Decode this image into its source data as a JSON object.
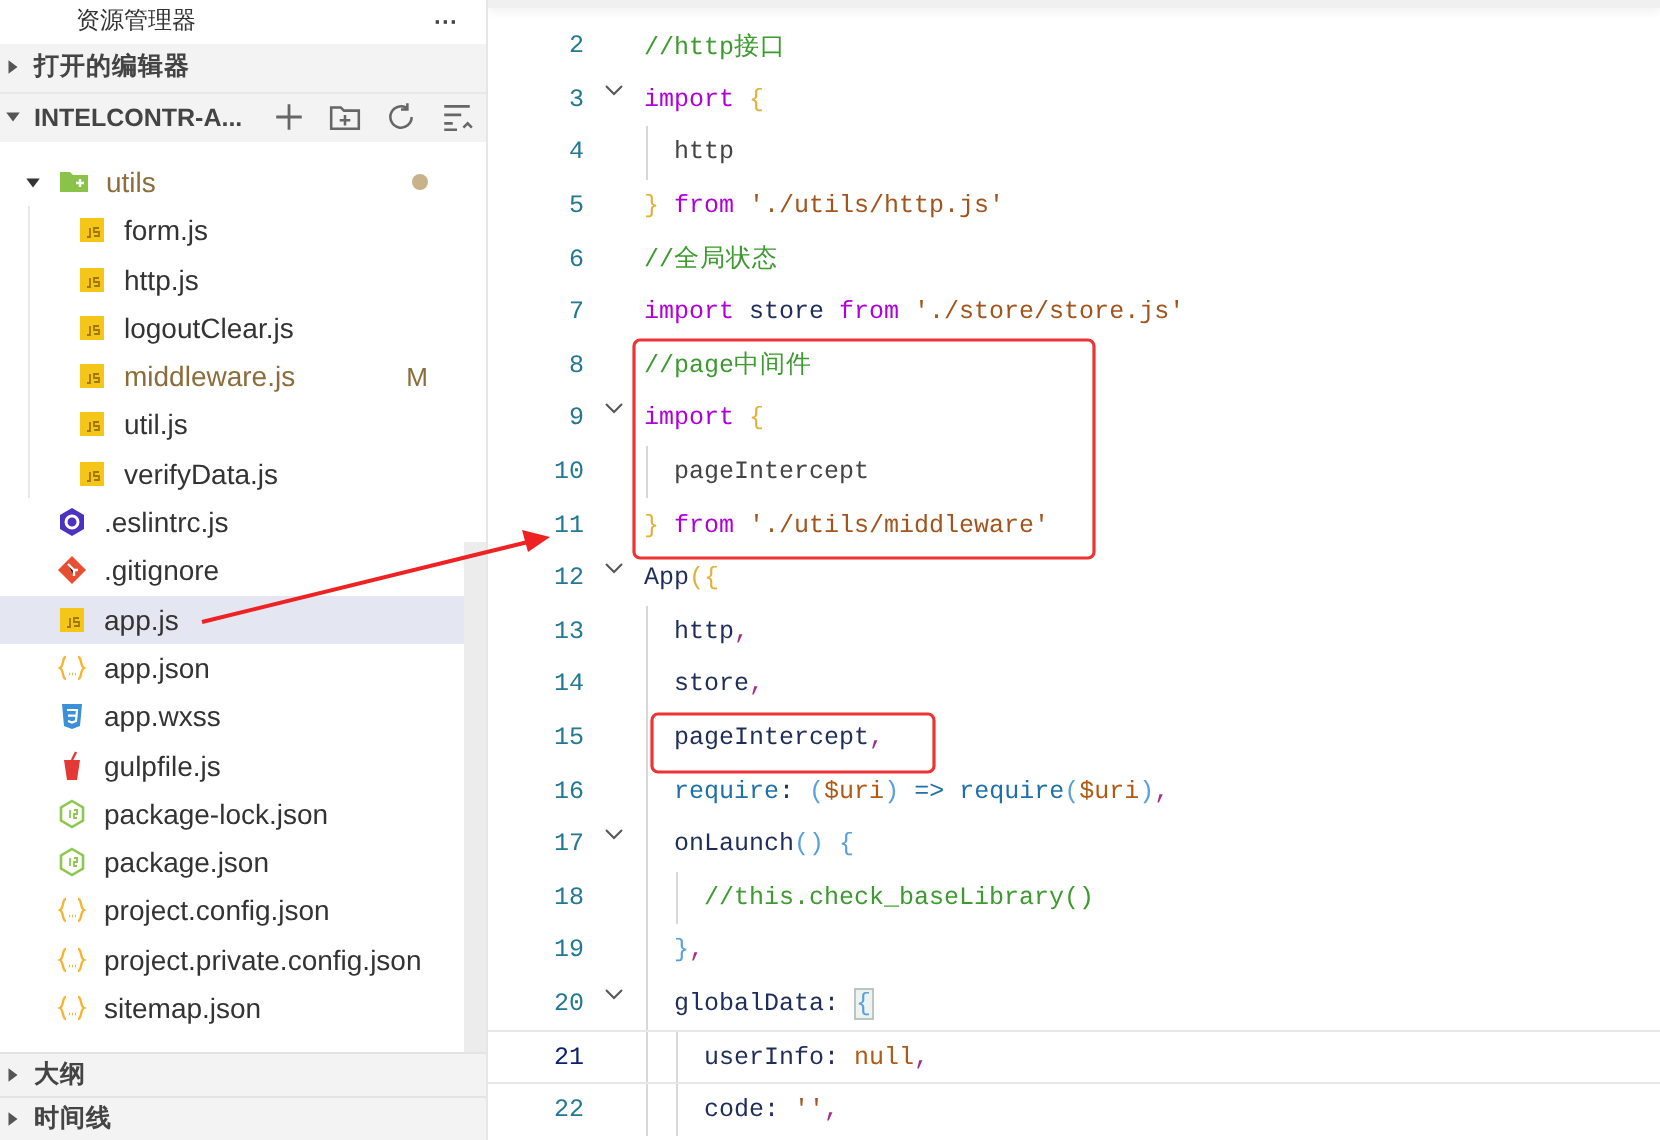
{
  "sidebar": {
    "title": "资源管理器",
    "more": "···",
    "sections_top": [
      {
        "label": "打开的编辑器",
        "expanded": false
      }
    ],
    "project": {
      "label": "INTELCONTR-A...",
      "expanded": true
    },
    "tree": [
      {
        "name": "utils",
        "kind": "folder",
        "expanded": true,
        "modified": true,
        "selected": false,
        "children": [
          {
            "name": "form.js",
            "kind": "js",
            "modified": false,
            "selected": false
          },
          {
            "name": "http.js",
            "kind": "js",
            "modified": false,
            "selected": false
          },
          {
            "name": "logoutClear.js",
            "kind": "js",
            "modified": false,
            "selected": false
          },
          {
            "name": "middleware.js",
            "kind": "js",
            "modified": true,
            "badge": "M",
            "selected": false
          },
          {
            "name": "util.js",
            "kind": "js",
            "modified": false,
            "selected": false
          },
          {
            "name": "verifyData.js",
            "kind": "js",
            "modified": false,
            "selected": false
          }
        ]
      },
      {
        "name": ".eslintrc.js",
        "kind": "eslint",
        "modified": false,
        "selected": false
      },
      {
        "name": ".gitignore",
        "kind": "git",
        "modified": false,
        "selected": false
      },
      {
        "name": "app.js",
        "kind": "js",
        "modified": false,
        "selected": true
      },
      {
        "name": "app.json",
        "kind": "json",
        "modified": false,
        "selected": false
      },
      {
        "name": "app.wxss",
        "kind": "css",
        "modified": false,
        "selected": false
      },
      {
        "name": "gulpfile.js",
        "kind": "gulp",
        "modified": false,
        "selected": false
      },
      {
        "name": "package-lock.json",
        "kind": "node",
        "modified": false,
        "selected": false
      },
      {
        "name": "package.json",
        "kind": "node",
        "modified": false,
        "selected": false
      },
      {
        "name": "project.config.json",
        "kind": "json",
        "modified": false,
        "selected": false
      },
      {
        "name": "project.private.config.json",
        "kind": "json",
        "modified": false,
        "selected": false
      },
      {
        "name": "sitemap.json",
        "kind": "json",
        "modified": false,
        "selected": false
      }
    ],
    "sections_bottom": [
      {
        "label": "大纲",
        "expanded": false
      },
      {
        "label": "时间线",
        "expanded": false
      }
    ]
  },
  "editor": {
    "lines": [
      {
        "number": "2",
        "current": false,
        "tokens": [
          {
            "kind": "comment",
            "text": "//http接口"
          }
        ]
      },
      {
        "number": "3",
        "current": false,
        "expanded": true,
        "tokens": [
          {
            "kind": "keyword",
            "text": "import"
          },
          {
            "kind": "brace",
            "text": " {"
          }
        ],
        "children": [
          {
            "number": "4",
            "current": false,
            "tokens": [
              {
                "kind": "plain",
                "text": "http"
              }
            ]
          }
        ]
      },
      {
        "number": "5",
        "current": false,
        "tokens": [
          {
            "kind": "brace",
            "text": "}"
          },
          {
            "kind": "keyword",
            "text": " from "
          },
          {
            "kind": "string",
            "text": "'./utils/http.js'"
          }
        ]
      },
      {
        "number": "6",
        "current": false,
        "tokens": [
          {
            "kind": "comment",
            "text": "//全局状态"
          }
        ]
      },
      {
        "number": "7",
        "current": false,
        "tokens": [
          {
            "kind": "keyword",
            "text": "import "
          },
          {
            "kind": "variable",
            "text": "store"
          },
          {
            "kind": "keyword",
            "text": " from "
          },
          {
            "kind": "string",
            "text": "'./store/store.js'"
          }
        ]
      },
      {
        "number": "8",
        "current": false,
        "tokens": [
          {
            "kind": "comment",
            "text": "//page中间件"
          }
        ]
      },
      {
        "number": "9",
        "current": false,
        "expanded": true,
        "tokens": [
          {
            "kind": "keyword",
            "text": "import"
          },
          {
            "kind": "brace",
            "text": " {"
          }
        ],
        "children": [
          {
            "number": "10",
            "current": false,
            "tokens": [
              {
                "kind": "plain",
                "text": "pageIntercept"
              }
            ]
          }
        ]
      },
      {
        "number": "11",
        "current": false,
        "tokens": [
          {
            "kind": "brace",
            "text": "}"
          },
          {
            "kind": "keyword",
            "text": " from "
          },
          {
            "kind": "string",
            "text": "'./utils/middleware'"
          }
        ]
      },
      {
        "number": "12",
        "current": false,
        "expanded": true,
        "tokens": [
          {
            "kind": "variable",
            "text": "App"
          },
          {
            "kind": "brace",
            "text": "({"
          }
        ],
        "children": [
          {
            "number": "13",
            "current": false,
            "tokens": [
              {
                "kind": "variable",
                "text": "http"
              },
              {
                "kind": "punct",
                "text": ","
              }
            ]
          },
          {
            "number": "14",
            "current": false,
            "tokens": [
              {
                "kind": "variable",
                "text": "store"
              },
              {
                "kind": "punct",
                "text": ","
              }
            ]
          },
          {
            "number": "15",
            "current": false,
            "tokens": [
              {
                "kind": "variable",
                "text": "pageIntercept"
              },
              {
                "kind": "punct",
                "text": ","
              }
            ]
          },
          {
            "number": "16",
            "current": false,
            "tokens": [
              {
                "kind": "property",
                "text": "require"
              },
              {
                "kind": "variable",
                "text": ": "
              },
              {
                "kind": "brace2",
                "text": "("
              },
              {
                "kind": "param",
                "text": "$uri"
              },
              {
                "kind": "brace2",
                "text": ")"
              },
              {
                "kind": "property",
                "text": " => require"
              },
              {
                "kind": "brace2",
                "text": "("
              },
              {
                "kind": "param",
                "text": "$uri"
              },
              {
                "kind": "brace2",
                "text": ")"
              },
              {
                "kind": "punct",
                "text": ","
              }
            ]
          },
          {
            "number": "17",
            "current": false,
            "expanded": true,
            "tokens": [
              {
                "kind": "variable",
                "text": "onLaunch"
              },
              {
                "kind": "brace2",
                "text": "() {"
              }
            ],
            "children": [
              {
                "number": "18",
                "current": false,
                "tokens": [
                  {
                    "kind": "comment",
                    "text": "//this.check_baseLibrary()"
                  }
                ]
              }
            ]
          },
          {
            "number": "19",
            "current": false,
            "tokens": [
              {
                "kind": "brace2",
                "text": "}"
              },
              {
                "kind": "punct",
                "text": ","
              }
            ]
          },
          {
            "number": "20",
            "current": false,
            "expanded": true,
            "tokens": [
              {
                "kind": "variable",
                "text": "globalData: "
              },
              {
                "kind": "brace-match",
                "text": "{"
              }
            ],
            "children": [
              {
                "number": "21",
                "current": true,
                "tokens": [
                  {
                    "kind": "variable",
                    "text": "userInfo: "
                  },
                  {
                    "kind": "param",
                    "text": "null"
                  },
                  {
                    "kind": "punct",
                    "text": ","
                  }
                ]
              },
              {
                "number": "22",
                "current": false,
                "tokens": [
                  {
                    "kind": "variable",
                    "text": "code: "
                  },
                  {
                    "kind": "string",
                    "text": "''"
                  },
                  {
                    "kind": "punct",
                    "text": ","
                  }
                ]
              }
            ]
          }
        ]
      }
    ]
  }
}
